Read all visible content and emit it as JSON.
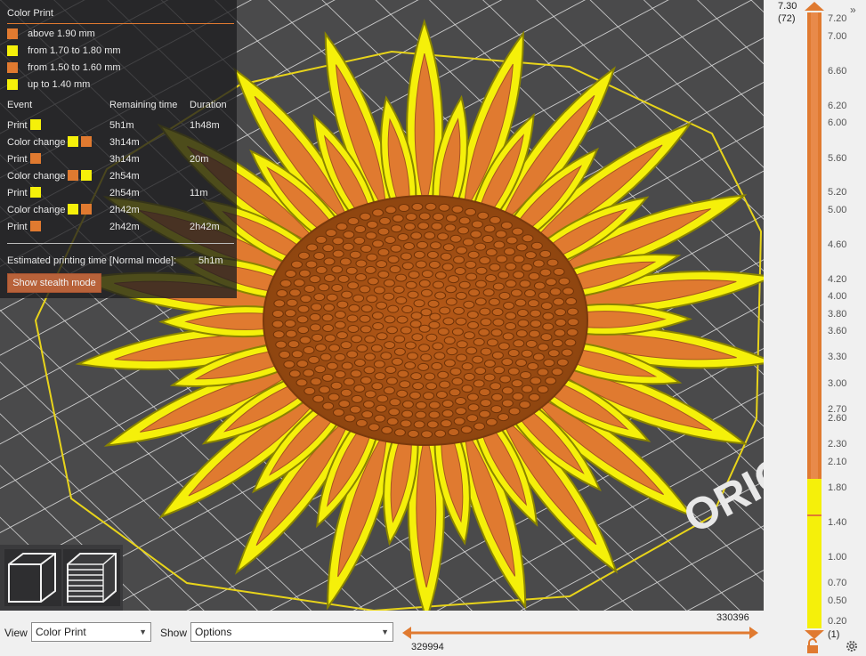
{
  "legend": {
    "title": "Color Print",
    "ranges": [
      {
        "label": "above 1.90 mm",
        "color": "#e07a30"
      },
      {
        "label": "from 1.70 to 1.80 mm",
        "color": "#f5f00a"
      },
      {
        "label": "from 1.50 to 1.60 mm",
        "color": "#e07a30"
      },
      {
        "label": "up to 1.40 mm",
        "color": "#f5f00a"
      }
    ],
    "headers": {
      "event": "Event",
      "remaining": "Remaining time",
      "duration": "Duration"
    },
    "events": [
      {
        "event": "Print",
        "swatches": [
          "#f5f00a"
        ],
        "remaining": "5h1m",
        "duration": "1h48m"
      },
      {
        "event": "Color change",
        "swatches": [
          "#f5f00a",
          "#e07a30"
        ],
        "remaining": "3h14m",
        "duration": ""
      },
      {
        "event": "Print",
        "swatches": [
          "#e07a30"
        ],
        "remaining": "3h14m",
        "duration": "20m"
      },
      {
        "event": "Color change",
        "swatches": [
          "#e07a30",
          "#f5f00a"
        ],
        "remaining": "2h54m",
        "duration": ""
      },
      {
        "event": "Print",
        "swatches": [
          "#f5f00a"
        ],
        "remaining": "2h54m",
        "duration": "11m"
      },
      {
        "event": "Color change",
        "swatches": [
          "#f5f00a",
          "#e07a30"
        ],
        "remaining": "2h42m",
        "duration": ""
      },
      {
        "event": "Print",
        "swatches": [
          "#e07a30"
        ],
        "remaining": "2h42m",
        "duration": "2h42m"
      }
    ],
    "estimate_label": "Estimated printing time [Normal mode]:",
    "estimate_value": "5h1m",
    "stealth_button": "Show stealth mode"
  },
  "toolbar": {
    "view_label": "View",
    "view_value": "Color Print",
    "show_label": "Show",
    "show_value": "Options"
  },
  "horizontal_slider": {
    "upper_value": "330396",
    "lower_value": "329994"
  },
  "vertical_slider": {
    "top_height": "7.30",
    "top_layer": "(72)",
    "bottom_height": "0.20",
    "bottom_layer": "(1)",
    "ticks": [
      "7.20",
      "7.00",
      "6.60",
      "6.20",
      "6.00",
      "5.60",
      "5.20",
      "5.00",
      "4.60",
      "4.20",
      "4.00",
      "3.80",
      "3.60",
      "3.30",
      "3.00",
      "2.70",
      "2.60",
      "2.30",
      "2.10",
      "1.80",
      "1.40",
      "1.00",
      "0.70",
      "0.50",
      "0.20"
    ]
  },
  "bed_text": "ORIGINAL",
  "colors": {
    "orange": "#e07a30",
    "yellow": "#f5f00a",
    "bed": "#4a4a4b",
    "accent": "#e07a30"
  },
  "icons": [
    "iso-cube-icon",
    "layers-icon",
    "undo-arrow-icon",
    "lock-icon",
    "gear-icon",
    "collapse-sidebar-icon"
  ]
}
